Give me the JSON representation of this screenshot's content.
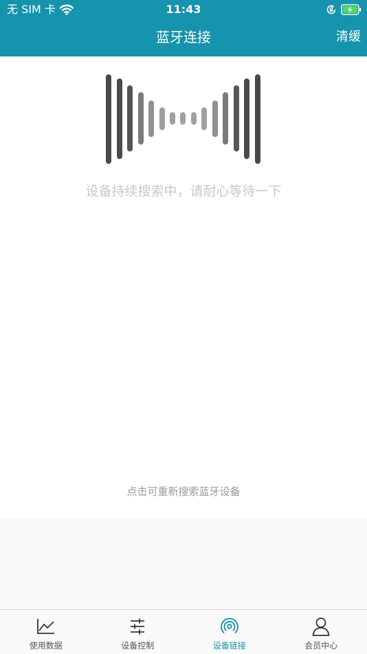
{
  "status_bar": {
    "carrier": "无 SIM 卡",
    "time": "11:43"
  },
  "nav": {
    "title": "蓝牙连接",
    "action": "清缓"
  },
  "content": {
    "search_message": "设备持续搜索中，请耐心等待一下",
    "rescan_label": "点击可重新搜索蓝牙设备"
  },
  "tabs": [
    {
      "label": "使用数据",
      "icon": "line-chart-icon"
    },
    {
      "label": "设备控制",
      "icon": "sliders-icon"
    },
    {
      "label": "设备链接",
      "icon": "bluetooth-signal-icon"
    },
    {
      "label": "会员中心",
      "icon": "user-icon"
    }
  ],
  "colors": {
    "accent": "#1693ad",
    "wave_dark": "#4a4a4a",
    "wave_mid": "#7a7a7a",
    "wave_light": "#a0a0a0",
    "battery": "#4cd964"
  }
}
